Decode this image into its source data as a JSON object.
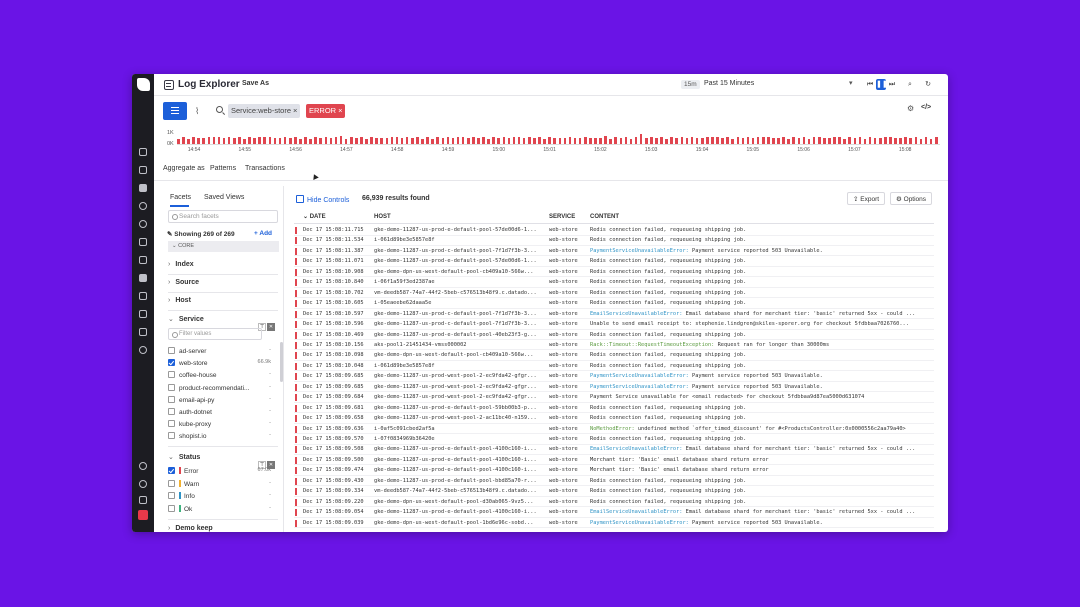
{
  "header": {
    "title": "Log Explorer",
    "save_as": "Save As",
    "time_badge": "15m",
    "time_range": "Past 15 Minutes"
  },
  "query": {
    "service_pill": "Service:web-store",
    "status_pill": "ERROR",
    "remove": "×"
  },
  "histogram": {
    "y_labels": [
      "1K",
      "0K"
    ],
    "x_ticks": [
      "14:54",
      "14:55",
      "14:56",
      "14:57",
      "14:58",
      "14:59",
      "15:00",
      "15:01",
      "15:02",
      "15:03",
      "15:04",
      "15:05",
      "15:06",
      "15:07",
      "15:08"
    ]
  },
  "aggregate": {
    "label": "Aggregate as",
    "tabs": [
      "Patterns",
      "Transactions"
    ]
  },
  "facets": {
    "tabs": [
      "Facets",
      "Saved Views"
    ],
    "search_placeholder": "Search facets",
    "showing": "Showing 269 of 269",
    "add": "Add",
    "core": "CORE",
    "groups": [
      "Index",
      "Source",
      "Host",
      "Service"
    ],
    "filter_placeholder": "Filter values",
    "service_values": [
      {
        "name": "ad-server",
        "count": "-",
        "checked": false
      },
      {
        "name": "web-store",
        "count": "66.9k",
        "checked": true
      },
      {
        "name": "coffee-house",
        "count": "-",
        "checked": false
      },
      {
        "name": "product-recommendati...",
        "count": "-",
        "checked": false
      },
      {
        "name": "email-api-py",
        "count": "-",
        "checked": false
      },
      {
        "name": "auth-dotnet",
        "count": "-",
        "checked": false
      },
      {
        "name": "kube-proxy",
        "count": "-",
        "checked": false
      },
      {
        "name": "shopist.io",
        "count": "-",
        "checked": false
      }
    ],
    "status_title": "Status",
    "status_values": [
      {
        "name": "Error",
        "count": "67.0k",
        "checked": true,
        "color": "#e0454f"
      },
      {
        "name": "Warn",
        "count": "-",
        "checked": false,
        "color": "#f2b130"
      },
      {
        "name": "Info",
        "count": "-",
        "checked": false,
        "color": "#2f93c6"
      },
      {
        "name": "Ok",
        "count": "-",
        "checked": false,
        "color": "#3fb37f"
      }
    ],
    "more_group": "Demo keep"
  },
  "results": {
    "hide_controls": "Hide Controls",
    "count": "66,939 results found",
    "export": "Export",
    "options": "Options",
    "columns": [
      "DATE",
      "HOST",
      "SERVICE",
      "CONTENT"
    ],
    "rows": [
      {
        "date": "Dec 17 15:08:11.715",
        "host": "gke-demo-11287-us-prod-e-default-pool-57de00d6-1...",
        "service": "web-store",
        "content": "Redis connection failed, requeueing shipping job."
      },
      {
        "date": "Dec 17 15:08:11.534",
        "host": "i-061d89be3e5857e8f",
        "service": "web-store",
        "content": "Redis connection failed, requeueing shipping job."
      },
      {
        "date": "Dec 17 15:08:11.387",
        "host": "gke-demo-11287-us-prod-c-default-pool-7f1d7f3b-3...",
        "service": "web-store",
        "content": "PaymentServiceUnavailableError: Payment service reported 503 Unavailable.",
        "err": "PaymentServiceUnavailableError:"
      },
      {
        "date": "Dec 17 15:08:11.071",
        "host": "gke-demo-11287-us-prod-e-default-pool-57de00d6-1...",
        "service": "web-store",
        "content": "Redis connection failed, requeueing shipping job."
      },
      {
        "date": "Dec 17 15:08:10.908",
        "host": "gke-demo-dpn-us-west-default-pool-cb409a10-566w...",
        "service": "web-store",
        "content": "Redis connection failed, requeueing shipping job."
      },
      {
        "date": "Dec 17 15:08:10.840",
        "host": "i-06f1a59f3ed2387ae",
        "service": "web-store",
        "content": "Redis connection failed, requeueing shipping job."
      },
      {
        "date": "Dec 17 15:08:10.702",
        "host": "vm-deedb587-74a7-44f2-5beb-c576513b48f9.c.datado...",
        "service": "web-store",
        "content": "Redis connection failed, requeueing shipping job."
      },
      {
        "date": "Dec 17 15:08:10.605",
        "host": "i-05eaeebe62daaa5e",
        "service": "web-store",
        "content": "Redis connection failed, requeueing shipping job."
      },
      {
        "date": "Dec 17 15:08:10.597",
        "host": "gke-demo-11287-us-prod-c-default-pool-7f1d7f3b-3...",
        "service": "web-store",
        "content": "EmailServiceUnavailableError: Email database shard for merchant  tier: 'basic' returned 5xx - could ...",
        "err": "EmailServiceUnavailableError:"
      },
      {
        "date": "Dec 17 15:08:10.596",
        "host": "gke-demo-11287-us-prod-c-default-pool-7f1d7f3b-3...",
        "service": "web-store",
        "content": "Unable to send email receipt to: stephenie.lindgren@skiles-sporer.org for checkout 5fdbbaa7026760...",
        "ecolor": "#333"
      },
      {
        "date": "Dec 17 15:08:10.469",
        "host": "gke-demo-11287-us-prod-e-default-pool-40eb23f3-g...",
        "service": "web-store",
        "content": "Redis connection failed, requeueing shipping job."
      },
      {
        "date": "Dec 17 15:08:10.156",
        "host": "aks-pool1-21451434-vmss000002",
        "service": "web-store",
        "content": "Rack::Timeout::RequestTimeoutException: Request ran for longer than 30000ms",
        "err": "Rack::Timeout::RequestTimeoutException:"
      },
      {
        "date": "Dec 17 15:08:10.098",
        "host": "gke-demo-dpn-us-west-default-pool-cb409a10-566w...",
        "service": "web-store",
        "content": "Redis connection failed, requeueing shipping job."
      },
      {
        "date": "Dec 17 15:08:10.048",
        "host": "i-061d89be3e5857e8f",
        "service": "web-store",
        "content": "Redis connection failed, requeueing shipping job."
      },
      {
        "date": "Dec 17 15:08:09.685",
        "host": "gke-demo-11287-us-prod-west-pool-2-ec9fda42-gfgr...",
        "service": "web-store",
        "content": "PaymentServiceUnavailableError: Payment service reported 503 Unavailable.",
        "err": "PaymentServiceUnavailableError:"
      },
      {
        "date": "Dec 17 15:08:09.685",
        "host": "gke-demo-11287-us-prod-west-pool-2-ec9fda42-gfgr...",
        "service": "web-store",
        "content": "PaymentServiceUnavailableError: Payment service reported 503 Unavailable.",
        "err": "PaymentServiceUnavailableError:"
      },
      {
        "date": "Dec 17 15:08:09.684",
        "host": "gke-demo-11287-us-prod-west-pool-2-ec9fda42-gfgr...",
        "service": "web-store",
        "content": "Payment Service unavailable for <email redacted> for checkout 5fdbbaa9d87ea5000d631074"
      },
      {
        "date": "Dec 17 15:08:09.681",
        "host": "gke-demo-11287-us-prod-e-default-pool-59bb00b3-p...",
        "service": "web-store",
        "content": "Redis connection failed, requeueing shipping job."
      },
      {
        "date": "Dec 17 15:08:09.658",
        "host": "gke-demo-11287-us-prod-west-pool-2-ac11bc40-n159...",
        "service": "web-store",
        "content": "Redis connection failed, requeueing shipping job."
      },
      {
        "date": "Dec 17 15:08:09.636",
        "host": "i-0af5c091cbed2af5a",
        "service": "web-store",
        "content": "NoMethodError: undefined method `offer_timed_discount' for #<ProductsController:0x0000556c2aa79a40>",
        "err": "NoMethodError:"
      },
      {
        "date": "Dec 17 15:08:09.570",
        "host": "i-07f0834969b36420e",
        "service": "web-store",
        "content": "Redis connection failed, requeueing shipping job."
      },
      {
        "date": "Dec 17 15:08:09.508",
        "host": "gke-demo-11287-us-prod-e-default-pool-4100c160-i...",
        "service": "web-store",
        "content": "EmailServiceUnavailableError: Email database shard for merchant  tier: 'basic' returned 5xx - could ...",
        "err": "EmailServiceUnavailableError:"
      },
      {
        "date": "Dec 17 15:08:09.500",
        "host": "gke-demo-11287-us-prod-e-default-pool-4100c160-i...",
        "service": "web-store",
        "content": "Merchant  tier: 'Basic' email database shard return error"
      },
      {
        "date": "Dec 17 15:08:09.474",
        "host": "gke-demo-11287-us-prod-e-default-pool-4100c160-i...",
        "service": "web-store",
        "content": "Merchant  tier: 'Basic' email database shard return error"
      },
      {
        "date": "Dec 17 15:08:09.430",
        "host": "gke-demo-11287-us-prod-e-default-pool-bbd85a70-r...",
        "service": "web-store",
        "content": "Redis connection failed, requeueing shipping job."
      },
      {
        "date": "Dec 17 15:08:09.334",
        "host": "vm-deedb587-74a7-44f2-5beb-c576513b48f9.c.datado...",
        "service": "web-store",
        "content": "Redis connection failed, requeueing shipping job."
      },
      {
        "date": "Dec 17 15:08:09.220",
        "host": "gke-demo-dpn-us-west-default-pool-d30ab065-9vz5...",
        "service": "web-store",
        "content": "Redis connection failed, requeueing shipping job."
      },
      {
        "date": "Dec 17 15:08:09.054",
        "host": "gke-demo-11287-us-prod-e-default-pool-4100c160-i...",
        "service": "web-store",
        "content": "EmailServiceUnavailableError: Email database shard for merchant  tier: 'basic' returned 5xx - could ...",
        "err": "EmailServiceUnavailableError:"
      },
      {
        "date": "Dec 17 15:08:09.039",
        "host": "gke-demo-dpn-us-west-default-pool-1bd6e96c-sobd...",
        "service": "web-store",
        "content": "PaymentServiceUnavailableError: Payment service reported 503 Unavailable.",
        "err": "PaymentServiceUnavailableError:"
      }
    ]
  },
  "colors": {
    "accent": "#1c5fd9",
    "error": "#e0454f",
    "background": "#6a14e6"
  }
}
